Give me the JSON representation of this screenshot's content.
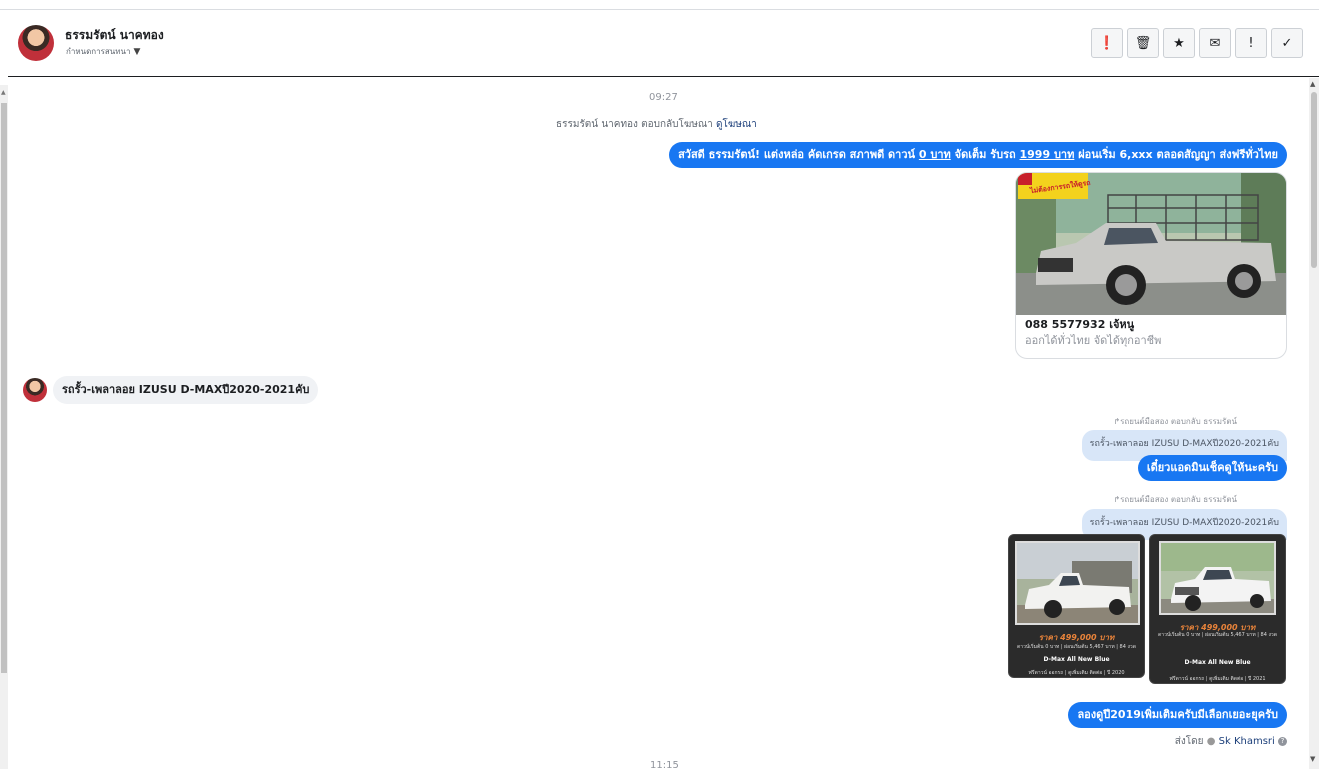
{
  "header": {
    "name": "ธรรมรัตน์ นาคทอง",
    "assign_label": "กำหนดการสนทนา",
    "actions": [
      {
        "icon": "alert-circle-icon",
        "glyph": "❗"
      },
      {
        "icon": "trash-icon",
        "glyph": "🗑"
      },
      {
        "icon": "star-icon",
        "glyph": "★"
      },
      {
        "icon": "mail-icon",
        "glyph": "✉"
      },
      {
        "icon": "exclamation-icon",
        "glyph": "!"
      },
      {
        "icon": "check-icon",
        "glyph": "✓"
      }
    ]
  },
  "messages": {
    "time1": "09:27",
    "ad_reply_prefix": "ธรรมรัตน์ นาคทอง ตอบกลับโฆษณา",
    "ad_reply_link": "ดูโฆษณา",
    "greeting_a": "สวัสดี ธรรมรัตน์! แต่งหล่อ คัดเกรด สภาพดี ดาวน์ ",
    "greeting_b": "0 บาท",
    "greeting_c": " จัดเต็ม รับรถ ",
    "greeting_d": "1999 บาท",
    "greeting_e": " ผ่อนเริ่ม 6,xxx ตลอดสัญญา ส่งฟรีทั่วไทย",
    "card_title": "088 5577932 เจ้หนู",
    "card_subtitle": "ออกได้ทั่วไทย จัดได้ทุกอาชีพ",
    "card_banner": "ไม่ต้องการรถให้ดูรถ",
    "incoming1": "รถรั้ว-เพลาลอย IZUSU D-MAXปี2020-2021คับ",
    "reply_hdr1": "↱รถยนต์มือสอง ตอบกลับ ธรรมรัตน์",
    "quote1": "รถรั้ว-เพลาลอย IZUSU D-MAXปี2020-2021คับ",
    "reply1": "เดี๋ยวแอดมินเช็คดูให้นะครับ",
    "reply_hdr2": "↱รถยนต์มือสอง ตอบกลับ ธรรมรัตน์",
    "quote2": "รถรั้ว-เพลาลอย IZUSU D-MAXปี2020-2021คับ",
    "photos": [
      {
        "price": "ราคา 499,000 บาท",
        "line1": "ดาวน์เริ่มต้น 0 บาท | ผ่อนเริ่มต้น 5,467 บาท | 84 งวด",
        "model": "D-Max All New Blue",
        "footer": "ฟรีดาวน์ ออกรถ | ดูเพิ่มเติม ติดต่อ | ปี 2020"
      },
      {
        "price": "ราคา 499,000 บาท",
        "line1": "ดาวน์เริ่มต้น 0 บาท | ผ่อนเริ่มต้น 5,467 บาท | 84 งวด",
        "model": "D-Max All New Blue",
        "footer": "ฟรีดาวน์ ออกรถ | ดูเพิ่มเติม ติดต่อ | ปี 2021"
      }
    ],
    "reply2": "ลองดูปี2019เพิ่มเติมครับมีเลือกเยอะยุครับ",
    "sent_by_label": "ส่งโดย",
    "sent_by_name": "Sk Khamsri",
    "time2": "11:15"
  }
}
